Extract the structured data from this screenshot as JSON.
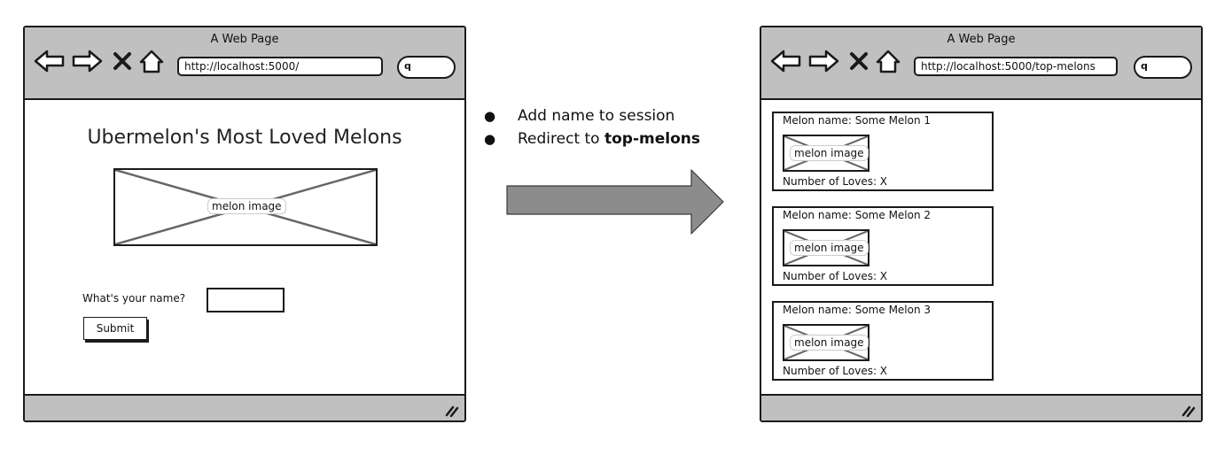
{
  "left_browser": {
    "window_title": "A Web Page",
    "url": "http://localhost:5000/",
    "page_title": "Ubermelon's Most Loved Melons",
    "image_label": "melon image",
    "form": {
      "label": "What's your name?",
      "input_value": "",
      "submit_label": "Submit"
    }
  },
  "flow": {
    "steps": [
      {
        "text": "Add name to session"
      },
      {
        "prefix": "Redirect to ",
        "bold": "top-melons"
      }
    ]
  },
  "right_browser": {
    "window_title": "A Web Page",
    "url": "http://localhost:5000/top-melons",
    "melons": [
      {
        "name": "Melon name: Some Melon 1",
        "image_label": "melon image",
        "loves": "Number of Loves: X"
      },
      {
        "name": "Melon name: Some Melon 2",
        "image_label": "melon image",
        "loves": "Number of Loves: X"
      },
      {
        "name": "Melon name: Some Melon 3",
        "image_label": "melon image",
        "loves": "Number of Loves: X"
      }
    ]
  },
  "colors": {
    "chrome_gray": "#c0c0c0",
    "arrow_fill": "#8c8c8c",
    "outline": "#1a1a1a"
  },
  "icons": [
    "back-arrow-icon",
    "forward-arrow-icon",
    "stop-icon",
    "home-icon",
    "search-icon",
    "resize-grip-icon",
    "bullet-icon"
  ]
}
